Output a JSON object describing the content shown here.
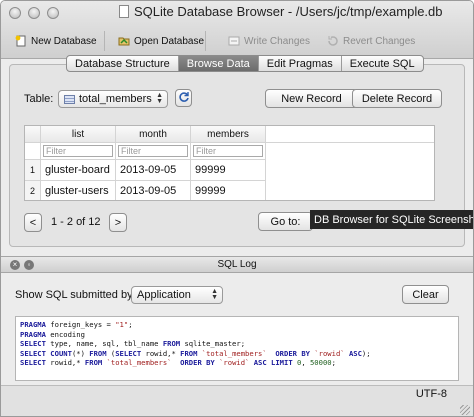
{
  "window": {
    "title": "SQLite Database Browser - /Users/jc/tmp/example.db"
  },
  "toolbar": {
    "new_database": "New Database",
    "open_database": "Open Database",
    "write_changes": "Write Changes",
    "revert_changes": "Revert Changes"
  },
  "tabs": [
    "Database Structure",
    "Browse Data",
    "Edit Pragmas",
    "Execute SQL"
  ],
  "browse": {
    "table_label": "Table:",
    "table_value": "total_members",
    "new_record": "New Record",
    "delete_record": "Delete Record",
    "columns": [
      "list",
      "month",
      "members"
    ],
    "filter_placeholder": "Filter",
    "rows": [
      {
        "num": "1",
        "list": "gluster-board",
        "month": "2013-09-05",
        "members": "99999"
      },
      {
        "num": "2",
        "list": "gluster-users",
        "month": "2013-09-05",
        "members": "99999"
      }
    ],
    "prev": "<",
    "next": ">",
    "page_info": "1 - 2 of 12",
    "goto": "Go to:"
  },
  "tooltip": "DB Browser for SQLite Screenshot",
  "log": {
    "title": "SQL Log",
    "show_label": "Show SQL submitted by",
    "source": "Application",
    "clear": "Clear",
    "lines": [
      "PRAGMA foreign_keys = \"1\";",
      "PRAGMA encoding",
      "SELECT type, name, sql, tbl_name FROM sqlite_master;",
      "SELECT COUNT(*) FROM (SELECT rowid,* FROM `total_members`  ORDER BY `rowid` ASC);",
      "SELECT rowid,* FROM `total_members`  ORDER BY `rowid` ASC LIMIT 0, 50000;"
    ]
  },
  "status": {
    "encoding": "UTF-8"
  },
  "icons": [
    "new-database-icon",
    "open-database-icon",
    "write-changes-icon",
    "revert-changes-icon",
    "refresh-icon",
    "table-icon",
    "close-icon",
    "float-icon"
  ]
}
